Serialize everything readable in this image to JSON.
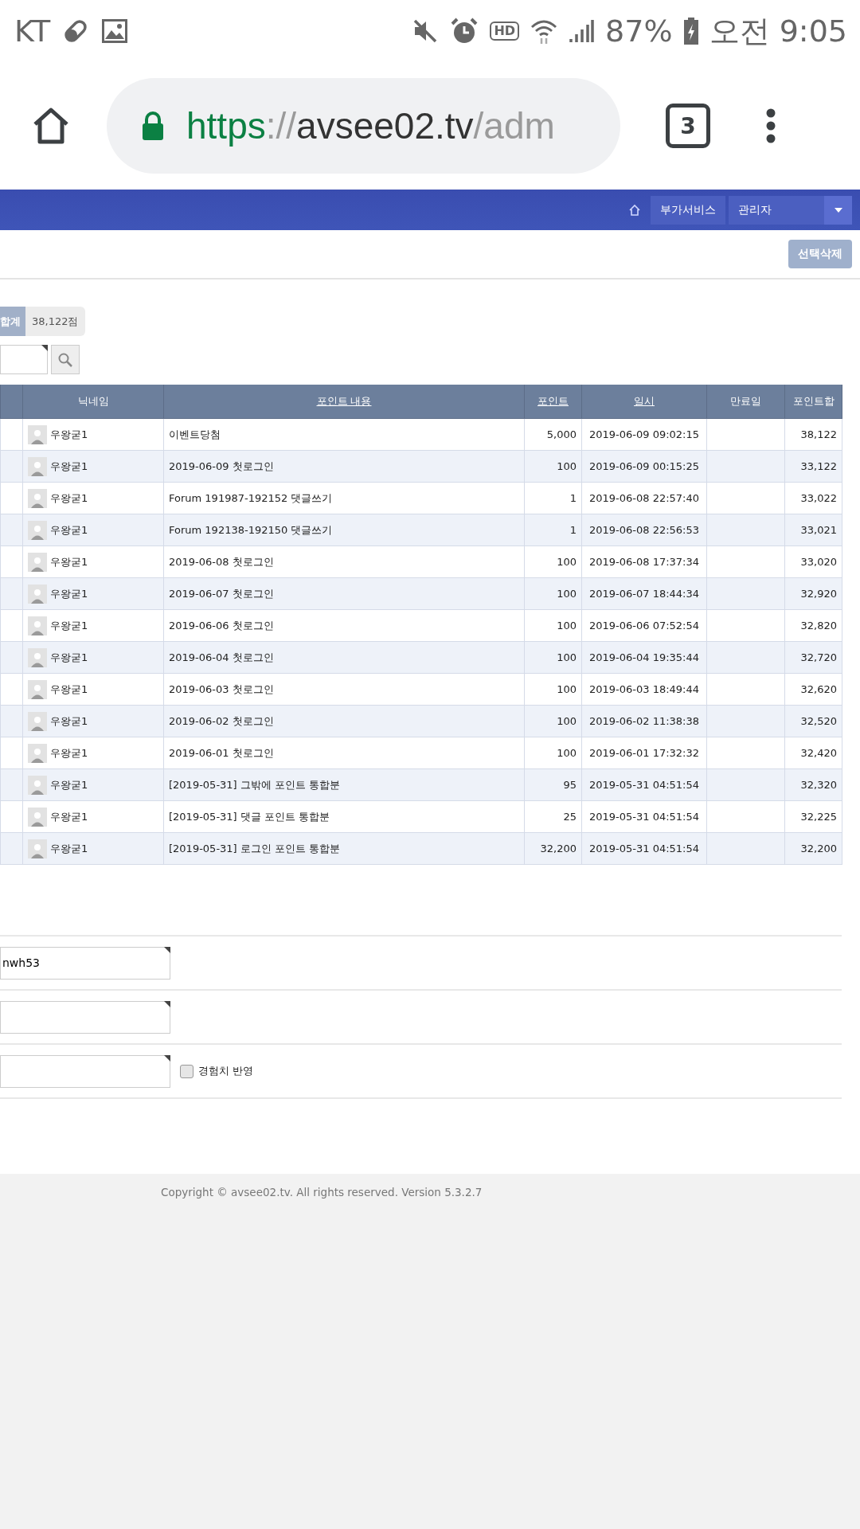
{
  "status_bar": {
    "carrier": "KT",
    "hd": "HD",
    "battery": "87%",
    "time": "오전 9:05"
  },
  "browser": {
    "url": {
      "scheme": "https",
      "separator": "://",
      "host": "avsee02.tv",
      "path": "/adm"
    },
    "tab_count": "3"
  },
  "nav": {
    "items": [
      {
        "label": "부가서비스",
        "kind": "button"
      },
      {
        "label": "관리자",
        "kind": "dropdown"
      }
    ]
  },
  "toolbar": {
    "delete_button": "선택삭제"
  },
  "summary": {
    "label": "합계",
    "value": "38,122점"
  },
  "table": {
    "columns": [
      {
        "label": "닉네임",
        "sortable": false
      },
      {
        "label": "포인트 내용",
        "sortable": true
      },
      {
        "label": "포인트",
        "sortable": true
      },
      {
        "label": "일시",
        "sortable": true
      },
      {
        "label": "만료일",
        "sortable": false
      },
      {
        "label": "포인트합",
        "sortable": false
      }
    ],
    "rows": [
      {
        "nickname": "우왕굳1",
        "content": "이벤트당첨",
        "points": "5,000",
        "datetime": "2019-06-09 09:02:15",
        "total": "38,122"
      },
      {
        "nickname": "우왕굳1",
        "content": "2019-06-09 첫로그인",
        "points": "100",
        "datetime": "2019-06-09 00:15:25",
        "total": "33,122"
      },
      {
        "nickname": "우왕굳1",
        "content": "Forum 191987-192152 댓글쓰기",
        "points": "1",
        "datetime": "2019-06-08 22:57:40",
        "total": "33,022"
      },
      {
        "nickname": "우왕굳1",
        "content": "Forum 192138-192150 댓글쓰기",
        "points": "1",
        "datetime": "2019-06-08 22:56:53",
        "total": "33,021"
      },
      {
        "nickname": "우왕굳1",
        "content": "2019-06-08 첫로그인",
        "points": "100",
        "datetime": "2019-06-08 17:37:34",
        "total": "33,020"
      },
      {
        "nickname": "우왕굳1",
        "content": "2019-06-07 첫로그인",
        "points": "100",
        "datetime": "2019-06-07 18:44:34",
        "total": "32,920"
      },
      {
        "nickname": "우왕굳1",
        "content": "2019-06-06 첫로그인",
        "points": "100",
        "datetime": "2019-06-06 07:52:54",
        "total": "32,820"
      },
      {
        "nickname": "우왕굳1",
        "content": "2019-06-04 첫로그인",
        "points": "100",
        "datetime": "2019-06-04 19:35:44",
        "total": "32,720"
      },
      {
        "nickname": "우왕굳1",
        "content": "2019-06-03 첫로그인",
        "points": "100",
        "datetime": "2019-06-03 18:49:44",
        "total": "32,620"
      },
      {
        "nickname": "우왕굳1",
        "content": "2019-06-02 첫로그인",
        "points": "100",
        "datetime": "2019-06-02 11:38:38",
        "total": "32,520"
      },
      {
        "nickname": "우왕굳1",
        "content": "2019-06-01 첫로그인",
        "points": "100",
        "datetime": "2019-06-01 17:32:32",
        "total": "32,420"
      },
      {
        "nickname": "우왕굳1",
        "content": "[2019-05-31] 그밖에 포인트 통합분",
        "points": "95",
        "datetime": "2019-05-31 04:51:54",
        "total": "32,320"
      },
      {
        "nickname": "우왕굳1",
        "content": "[2019-05-31] 댓글 포인트 통합분",
        "points": "25",
        "datetime": "2019-05-31 04:51:54",
        "total": "32,225"
      },
      {
        "nickname": "우왕굳1",
        "content": "[2019-05-31] 로그인 포인트 통합분",
        "points": "32,200",
        "datetime": "2019-05-31 04:51:54",
        "total": "32,200"
      }
    ]
  },
  "form_rows": [
    {
      "value": "nwh53"
    },
    {},
    {
      "checkbox": {
        "label": "경험치 반영",
        "checked": false
      }
    }
  ],
  "footer": {
    "copyright": "Copyright © avsee02.tv. All rights reserved. Version 5.3.2.7"
  }
}
